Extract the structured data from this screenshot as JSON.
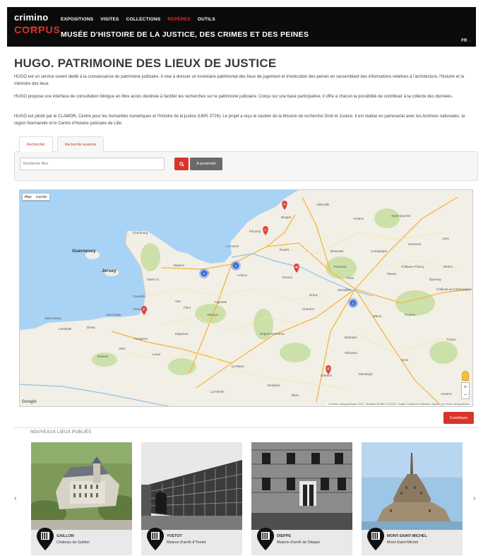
{
  "header": {
    "logo_line1": "crimino",
    "logo_line2": "CORPUS",
    "nav": [
      "EXPOSITIONS",
      "VISITES",
      "COLLECTIONS",
      "REPÈRES",
      "OUTILS"
    ],
    "active_nav": "REPÈRES",
    "site_title": "MUSÉE D'HISTOIRE DE LA JUSTICE, DES CRIMES ET DES PEINES",
    "lang": "FR"
  },
  "main": {
    "title": "HUGO. PATRIMOINE DES LIEUX DE JUSTICE",
    "paragraphs": [
      "HUGO est un service ouvert dédié à la connaissance du patrimoine judiciaire. Il vise à dresser un inventaire patrimonial des lieux de jugement et d'exécution des peines en rassemblant des informations relatives à l'architecture, l'histoire et la mémoire des lieux.",
      "HUGO propose une interface de consultation bilingue en libre accès destinée à faciliter les recherches sur le patrimoine judiciaire. Conçu sur une base participative, il offre à chacun la possibilité de contribuer à la collecte des données.",
      "HUGO est piloté par le CLAMOR, Centre pour les humanités numériques et l'histoire de la justice (UMS 3726). Le projet a reçu le soutien de la Mission de recherche Droit et Justice. Il est réalisé en partenariat avec les Archives nationales, la région Normandie et le Centre d'histoire judiciaire de Lille."
    ]
  },
  "search": {
    "tabs": [
      "Rechercher",
      "Recherche avancée"
    ],
    "placeholder": "Recherche libre",
    "proximity_label": "À proximité"
  },
  "map": {
    "type_options": [
      "Plan",
      "Satellite"
    ],
    "google": "Google",
    "attribution": "Données cartographiques ©2017 GeoBasis-DE/BKG (©2009), Google   Conditions d'utilisation   Signaler une erreur cartographique",
    "places": [
      {
        "label": "Guernesey",
        "kind": "island"
      },
      {
        "label": "Jersey",
        "kind": "island"
      },
      {
        "label": "Le Havre",
        "kind": "city"
      },
      {
        "label": "Caen",
        "kind": "city"
      },
      {
        "label": "Rouen",
        "kind": "city"
      },
      {
        "label": "Amiens",
        "kind": "city"
      },
      {
        "label": "Beauvais",
        "kind": "city"
      },
      {
        "label": "Compiègne",
        "kind": "city"
      },
      {
        "label": "Saint-Quentin",
        "kind": "city"
      },
      {
        "label": "Laon",
        "kind": "city"
      },
      {
        "label": "Reims",
        "kind": "city"
      },
      {
        "label": "Évreux",
        "kind": "city"
      },
      {
        "label": "Paris",
        "kind": "city"
      },
      {
        "label": "Versailles",
        "kind": "city"
      },
      {
        "label": "Meaux",
        "kind": "city"
      },
      {
        "label": "Châlons-en-Champagne",
        "kind": "city"
      },
      {
        "label": "Chartres",
        "kind": "city"
      },
      {
        "label": "Alençon",
        "kind": "city"
      },
      {
        "label": "Le Mans",
        "kind": "city"
      },
      {
        "label": "Laval",
        "kind": "city"
      },
      {
        "label": "Rennes",
        "kind": "city"
      },
      {
        "label": "Saint-Malo",
        "kind": "city"
      },
      {
        "label": "Saint-Brieuc",
        "kind": "city"
      },
      {
        "label": "Vire",
        "kind": "city"
      },
      {
        "label": "Orléans",
        "kind": "city"
      },
      {
        "label": "Troyes",
        "kind": "city"
      },
      {
        "label": "Auxerre",
        "kind": "city"
      },
      {
        "label": "Sens",
        "kind": "city"
      },
      {
        "label": "Fougères",
        "kind": "city"
      },
      {
        "label": "Bayeux",
        "kind": "city"
      },
      {
        "label": "Lisieux",
        "kind": "city"
      },
      {
        "label": "Dieppe",
        "kind": "city"
      },
      {
        "label": "Avranches",
        "kind": "city"
      },
      {
        "label": "Granville",
        "kind": "city"
      },
      {
        "label": "Nogent-le-Rotrou",
        "kind": "city"
      },
      {
        "label": "La Flèche",
        "kind": "city"
      },
      {
        "label": "Blois",
        "kind": "city"
      },
      {
        "label": "Montargis",
        "kind": "city"
      },
      {
        "label": "Provins",
        "kind": "city"
      },
      {
        "label": "Melun",
        "kind": "city"
      },
      {
        "label": "Pontoise",
        "kind": "city"
      },
      {
        "label": "Soissons",
        "kind": "city"
      },
      {
        "label": "Épernay",
        "kind": "city"
      },
      {
        "label": "Château-Thierry",
        "kind": "city"
      },
      {
        "label": "Abbeville",
        "kind": "city"
      },
      {
        "label": "Fécamp",
        "kind": "city"
      },
      {
        "label": "Cherbourg",
        "kind": "city"
      },
      {
        "label": "Saint-Lô",
        "kind": "city"
      },
      {
        "label": "Flers",
        "kind": "city"
      },
      {
        "label": "Mayenne",
        "kind": "city"
      },
      {
        "label": "Dreux",
        "kind": "city"
      },
      {
        "label": "Étampes",
        "kind": "city"
      },
      {
        "label": "Pithiviers",
        "kind": "city"
      },
      {
        "label": "Vendôme",
        "kind": "city"
      },
      {
        "label": "Argentan",
        "kind": "city"
      },
      {
        "label": "Dinan",
        "kind": "city"
      },
      {
        "label": "Vitré",
        "kind": "city"
      },
      {
        "label": "Lamballe",
        "kind": "city"
      }
    ],
    "markers": [
      {
        "label": "A",
        "color": "#d8453b"
      },
      {
        "label": "L",
        "color": "#d8453b"
      },
      {
        "label": "M",
        "color": "#d8453b"
      },
      {
        "label": "F",
        "color": "#d8453b"
      },
      {
        "label": "E",
        "color": "#d8453b"
      }
    ],
    "clusters": [
      {
        "count": "2"
      },
      {
        "count": "2"
      },
      {
        "count": "2"
      }
    ]
  },
  "contribute_label": "Contribuer",
  "recent": {
    "label": "NOUVEAUX LIEUX PUBLIÉS",
    "cards": [
      {
        "name": "GAILLON",
        "subtitle": "Château de Gaillon"
      },
      {
        "name": "YVETOT",
        "subtitle": "Maison d'arrêt d'Yvetot"
      },
      {
        "name": "DIEPPE",
        "subtitle": "Maison d'arrêt de Dieppe"
      },
      {
        "name": "MONT-SAINT-MICHEL",
        "subtitle": "Mont-Saint-Michel"
      }
    ],
    "prev": "‹",
    "next": "›"
  },
  "colors": {
    "accent": "#d9342b",
    "header_bg": "#0b0b0b",
    "sea": "#a9d3f5",
    "land": "#f2efe6",
    "forest": "#c8dfa3"
  }
}
